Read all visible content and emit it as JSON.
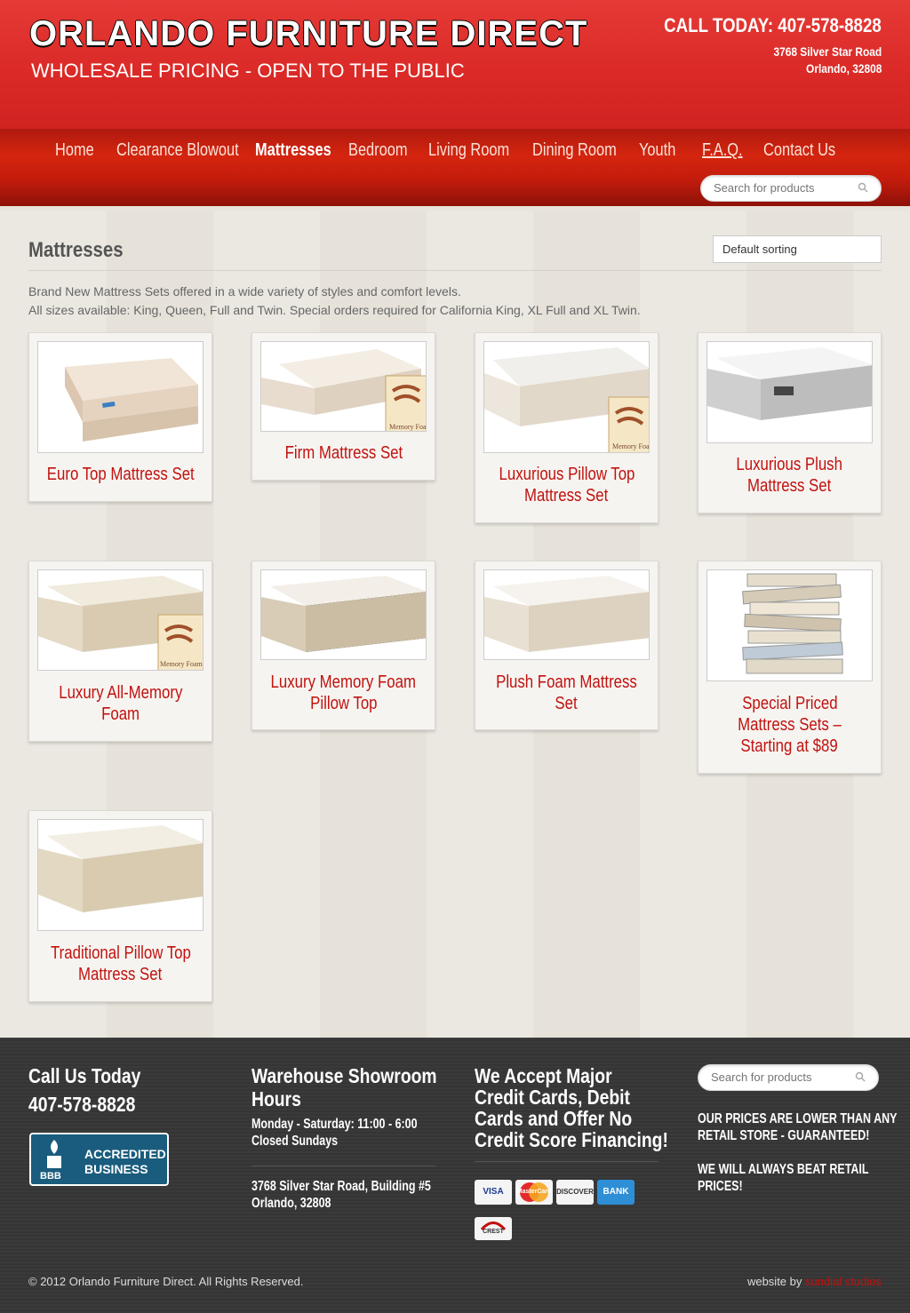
{
  "header": {
    "title": "ORLANDO FURNITURE DIRECT",
    "tagline": "WHOLESALE PRICING - OPEN TO THE PUBLIC",
    "call": "CALL TODAY: 407-578-8828",
    "address1": "3768 Silver Star Road",
    "address2": "Orlando, 32808"
  },
  "nav": {
    "items": [
      "Home",
      "Clearance Blowout",
      "Mattresses",
      "Bedroom",
      "Living Room",
      "Dining Room",
      "Youth",
      "F.A.Q.",
      "Contact Us"
    ],
    "active": "Mattresses",
    "search_placeholder": "Search for products"
  },
  "main": {
    "title": "Mattresses",
    "sort": "Default sorting",
    "desc1": "Brand New Mattress Sets offered in a wide variety of styles and comfort levels.",
    "desc2": "All sizes available: King, Queen, Full and Twin. Special orders required for California King, XL Full and XL Twin.",
    "products": [
      {
        "name1": "Euro Top Mattress Set",
        "name2": ""
      },
      {
        "name1": "Firm Mattress Set",
        "name2": ""
      },
      {
        "name1": "Luxurious Pillow Top",
        "name2": "Mattress Set"
      },
      {
        "name1": "Luxurious Plush",
        "name2": "Mattress Set"
      },
      {
        "name1": "Luxury All-Memory",
        "name2": "Foam"
      },
      {
        "name1": "Luxury Memory Foam",
        "name2": "Pillow Top"
      },
      {
        "name1": "Plush Foam Mattress",
        "name2": "Set"
      },
      {
        "name1": "Special Priced",
        "name2": "Mattress Sets –",
        "name3": "Starting at $89"
      },
      {
        "name1": "Traditional Pillow Top",
        "name2": "Mattress Set"
      }
    ],
    "memory_foam_badge": "Memory Foam"
  },
  "footer": {
    "call_heading1": "Call Us Today",
    "call_heading2": "407-578-8828",
    "bbb_line1": "ACCREDITED",
    "bbb_line2": "BUSINESS",
    "bbb_logo": "BBB",
    "hours_heading1": "Warehouse Showroom",
    "hours_heading2": "Hours",
    "hours1": "Monday - Saturday: 11:00 - 6:00",
    "hours2": "Closed Sundays",
    "addr1": "3768 Silver Star Road, Building #5",
    "addr2": "Orlando, 32808",
    "cards_heading1": "We Accept Major",
    "cards_heading2": "Credit Cards, Debit",
    "cards_heading3": "Cards and Offer No",
    "cards_heading4": "Credit Score Financing!",
    "card_logos": [
      "VISA",
      "MasterCard",
      "DISCOVER",
      "BANK",
      "CREST"
    ],
    "search_placeholder": "Search for products",
    "promo1a": "OUR PRICES ARE LOWER THAN ANY",
    "promo1b": "RETAIL STORE - GUARANTEED!",
    "promo2a": "WE WILL ALWAYS BEAT RETAIL",
    "promo2b": "PRICES!",
    "copyright": "© 2012 Orlando Furniture Direct. All Rights Reserved.",
    "credit_prefix": "website by ",
    "credit_name": "sundial studios"
  },
  "colors": {
    "brand_red": "#d72a26",
    "product_title": "#c1120e"
  }
}
